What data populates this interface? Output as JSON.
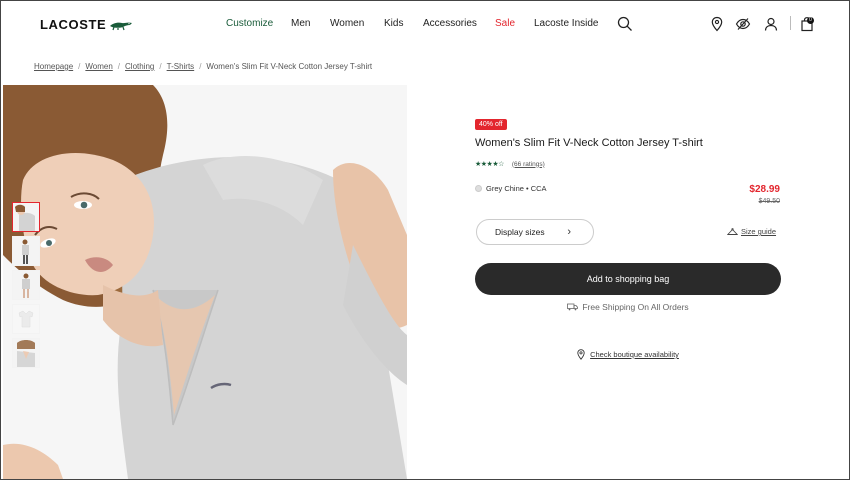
{
  "brand": {
    "name": "LACOSTE",
    "accent": "#1a5c3a",
    "sale_color": "#e3262e"
  },
  "nav": {
    "items": [
      {
        "label": "Customize"
      },
      {
        "label": "Men"
      },
      {
        "label": "Women"
      },
      {
        "label": "Kids"
      },
      {
        "label": "Accessories"
      },
      {
        "label": "Sale"
      },
      {
        "label": "Lacoste Inside"
      }
    ],
    "icons": [
      "search-icon",
      "store-locator-icon",
      "accessibility-icon",
      "account-icon",
      "shopping-bag-icon"
    ],
    "bag_count": "0"
  },
  "breadcrumb": {
    "links": [
      "Homepage",
      "Women",
      "Clothing",
      "T-Shirts"
    ],
    "current": "Women's Slim Fit V-Neck Cotton Jersey T-shirt"
  },
  "gallery": {
    "thumb_count": 5,
    "active_index": 0
  },
  "product": {
    "badge": "40% off",
    "title": "Women's Slim Fit V-Neck Cotton Jersey T-shirt",
    "stars": "★★★★☆",
    "rating_value": 4,
    "ratings_count": "(66 ratings)",
    "color_name": "Grey Chine • CCA",
    "price": "$28.99",
    "old_price": "$49.50",
    "sizes_label": "Display sizes",
    "size_guide_label": "Size guide",
    "add_to_bag_label": "Add to shopping bag",
    "shipping_label": "Free Shipping On All Orders",
    "boutique_label": "Check boutique availability"
  }
}
